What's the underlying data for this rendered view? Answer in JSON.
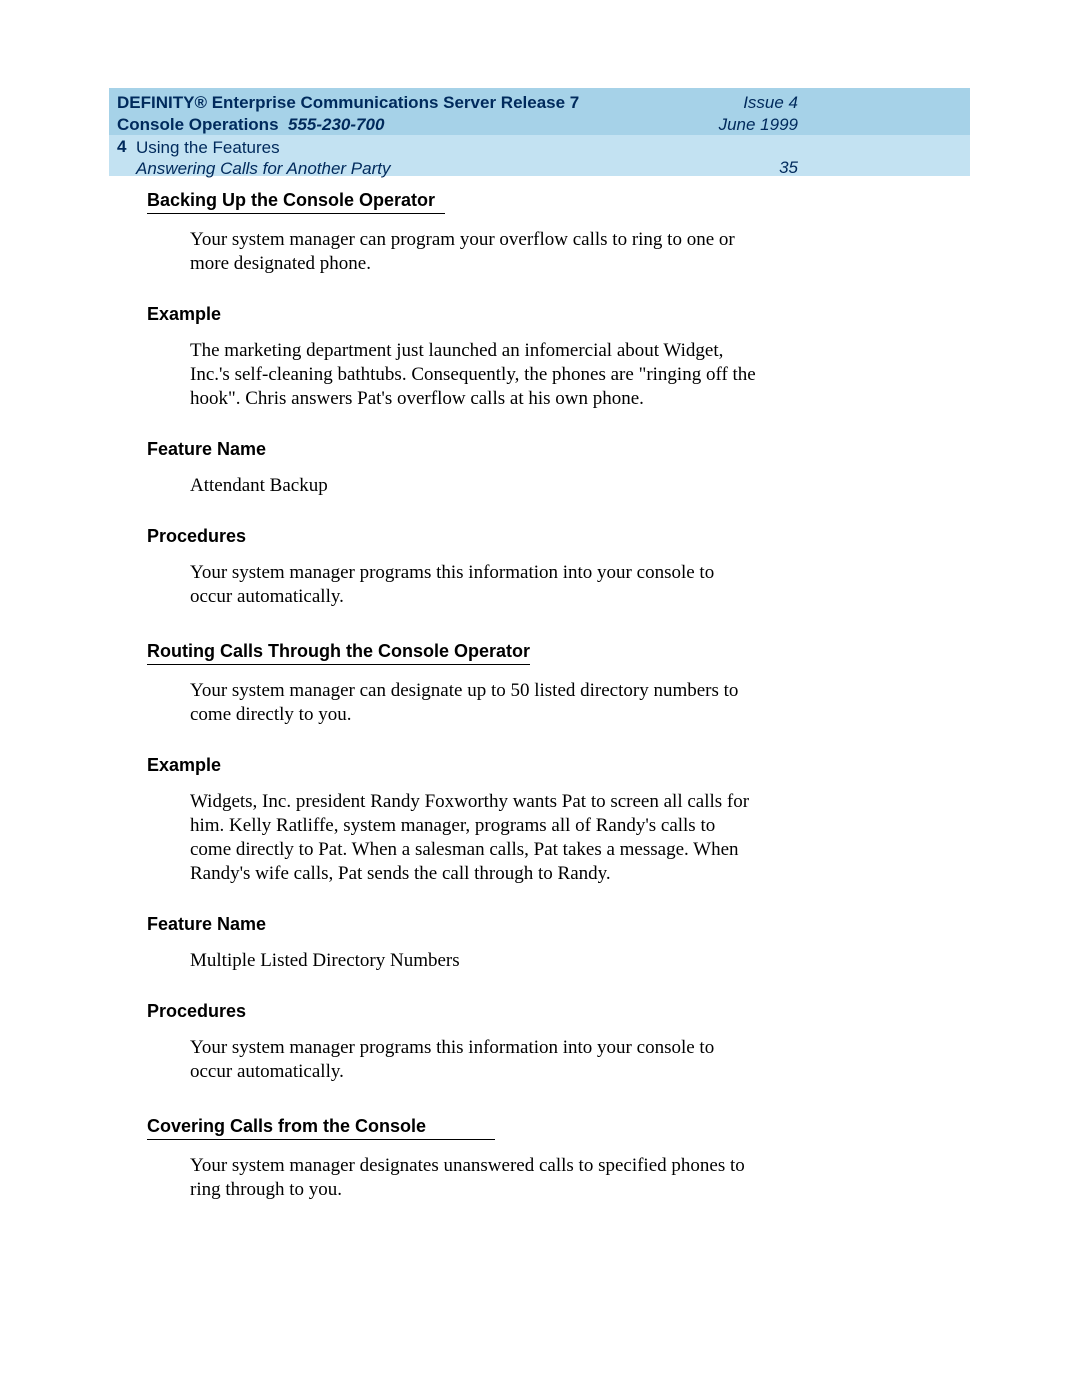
{
  "header": {
    "title_line1": "DEFINITY® Enterprise Communications Server Release 7",
    "title_line2a": "Console Operations",
    "title_line2b": "555-230-700",
    "issue": "Issue 4",
    "date": "June 1999",
    "chapter_num": "4",
    "chapter_title": "Using the Features",
    "section_title": "Answering Calls for Another Party",
    "page_num": "35"
  },
  "sections": [
    {
      "heading": "Backing Up the Console Operator",
      "intro": "Your system manager can program your overflow calls to ring to one or more designated phone.",
      "subs": [
        {
          "label": "Example",
          "text": "The marketing department just launched an infomercial about Widget, Inc.'s self-cleaning bathtubs. Consequently, the phones are \"ringing off the hook\". Chris answers Pat's overflow calls at his own phone."
        },
        {
          "label": "Feature Name",
          "text": "Attendant Backup"
        },
        {
          "label": "Procedures",
          "text": "Your system manager programs this information into your console to occur automatically."
        }
      ]
    },
    {
      "heading": "Routing Calls Through the Console Operator",
      "intro": "Your system manager can designate up to 50 listed directory numbers to come directly to you.",
      "subs": [
        {
          "label": "Example",
          "text": "Widgets, Inc. president Randy Foxworthy wants Pat to screen all calls for him. Kelly Ratliffe, system manager, programs all of Randy's calls to come directly to Pat. When a salesman calls, Pat takes a message. When Randy's wife calls, Pat sends the call through to Randy."
        },
        {
          "label": "Feature Name",
          "text": "Multiple Listed Directory Numbers"
        },
        {
          "label": "Procedures",
          "text": "Your system manager programs this information into your console to occur automatically."
        }
      ]
    },
    {
      "heading": "Covering Calls from the Console",
      "intro": "Your system manager designates unanswered calls to specified phones to ring through to you.",
      "subs": []
    }
  ]
}
